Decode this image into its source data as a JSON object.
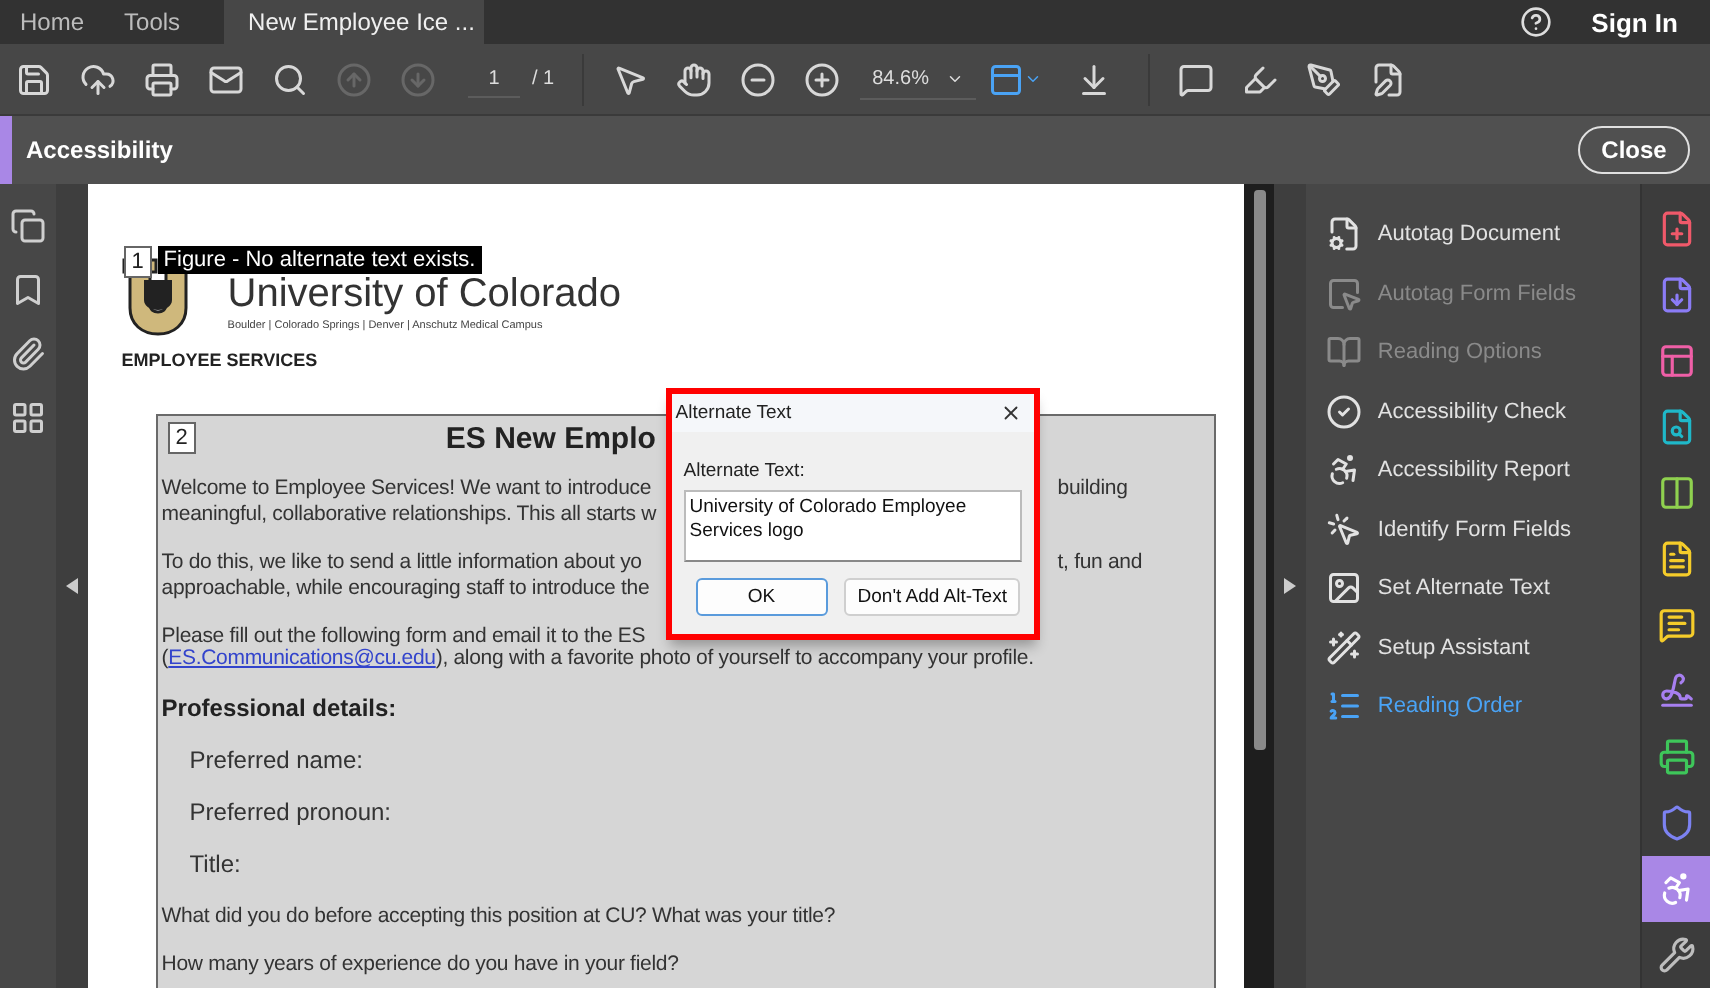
{
  "top_bar": {
    "tabs": [
      {
        "label": "Home",
        "selected": false
      },
      {
        "label": "Tools",
        "selected": false
      },
      {
        "label": "New Employee Ice ...",
        "selected": true
      }
    ],
    "sign_in": "Sign In"
  },
  "toolbar": {
    "groups": [
      [
        {
          "kind": "save",
          "disabled": false
        },
        {
          "kind": "upload",
          "disabled": false
        },
        {
          "kind": "print",
          "disabled": false
        },
        {
          "kind": "mail",
          "disabled": false
        },
        {
          "kind": "search",
          "disabled": false
        },
        {
          "kind": "prev",
          "disabled": true
        },
        {
          "kind": "next",
          "disabled": true
        },
        {
          "kind": "page",
          "value": "1",
          "total": "/ 1"
        }
      ],
      [
        {
          "kind": "select",
          "disabled": false
        },
        {
          "kind": "hand",
          "disabled": false
        },
        {
          "kind": "zoom_out",
          "disabled": false
        },
        {
          "kind": "zoom_in",
          "disabled": false
        },
        {
          "kind": "zoom",
          "value": "84.6%"
        },
        {
          "kind": "fit"
        },
        {
          "kind": "scroll",
          "disabled": false
        }
      ],
      [
        {
          "kind": "comment",
          "disabled": false
        },
        {
          "kind": "highlight",
          "disabled": false
        },
        {
          "kind": "sign",
          "disabled": false
        },
        {
          "kind": "fill_sign",
          "disabled": false
        }
      ]
    ]
  },
  "tool_header": {
    "title": "Accessibility",
    "close": "Close"
  },
  "document": {
    "figure_tag": "1",
    "tooltip": "Figure - No alternate text exists.",
    "logo_title": "University of Colorado",
    "logo_subtitle": "Boulder | Colorado Springs | Denver | Anschutz Medical Campus",
    "department": "EMPLOYEE SERVICES",
    "section_tag": "2",
    "heading": "ES New Emplo",
    "blocks": [
      {
        "kind": "para",
        "lines": [
          {
            "text": "Welcome to Employee Services! We want to introduce",
            "right": "building"
          },
          {
            "text": "meaningful, collaborative relationships. This all starts w"
          }
        ]
      },
      {
        "kind": "para",
        "lines": [
          {
            "text": "To do this, we like to send a little information about yo",
            "right": "t, fun and"
          },
          {
            "text": "approachable, while encouraging staff to introduce the"
          }
        ]
      },
      {
        "kind": "para",
        "lines": [
          {
            "text": "Please fill out the following form and email it to the ES"
          },
          {
            "pre": "(",
            "link": "ES.Communications@cu.edu",
            "text": "), along with a favorite photo of yourself to accompany your profile."
          }
        ]
      },
      {
        "kind": "heading",
        "text": "Professional details:"
      },
      {
        "kind": "field",
        "text": "Preferred name:"
      },
      {
        "kind": "field",
        "text": "Preferred pronoun:"
      },
      {
        "kind": "field",
        "text": "Title:"
      },
      {
        "kind": "para",
        "lines": [
          {
            "text": "What did you do before accepting this position at CU? What was your title?"
          }
        ]
      },
      {
        "kind": "para",
        "lines": [
          {
            "text": "How many years of experience do you have in your field?"
          }
        ]
      }
    ]
  },
  "dialog": {
    "title": "Alternate Text",
    "label": "Alternate Text:",
    "value": "University of Colorado Employee Services logo",
    "buttons": [
      {
        "label": "OK",
        "selected": true
      },
      {
        "label": "Don't Add Alt-Text",
        "selected": false
      }
    ]
  },
  "tools_panel": {
    "items": [
      {
        "label": "Autotag Document",
        "disabled": false,
        "selected": false
      },
      {
        "label": "Autotag Form Fields",
        "disabled": true,
        "selected": false
      },
      {
        "label": "Reading Options",
        "disabled": true,
        "selected": false
      },
      {
        "label": "Accessibility Check",
        "disabled": false,
        "selected": false
      },
      {
        "label": "Accessibility Report",
        "disabled": false,
        "selected": false
      },
      {
        "label": "Identify Form Fields",
        "disabled": false,
        "selected": false
      },
      {
        "label": "Set Alternate Text",
        "disabled": false,
        "selected": false
      },
      {
        "label": "Setup Assistant",
        "disabled": false,
        "selected": false
      },
      {
        "label": "Reading Order",
        "disabled": false,
        "selected": true
      }
    ]
  },
  "tool_rail": {
    "items": [
      {
        "color": "#f0596a",
        "selected": false
      },
      {
        "color": "#8b7cf6",
        "selected": false
      },
      {
        "color": "#ef5fa7",
        "selected": false
      },
      {
        "color": "#1fb8c9",
        "selected": false
      },
      {
        "color": "#8fd14f",
        "selected": false
      },
      {
        "color": "#f5cc2a",
        "selected": false
      },
      {
        "color": "#f5cc2a",
        "selected": false
      },
      {
        "color": "#a77ff0",
        "selected": false
      },
      {
        "color": "#3ec65a",
        "selected": false
      },
      {
        "color": "#7c82f2",
        "selected": false
      },
      {
        "color": "#a987e6",
        "selected": true
      },
      {
        "color": "#bdbdbd",
        "selected": false
      }
    ]
  }
}
